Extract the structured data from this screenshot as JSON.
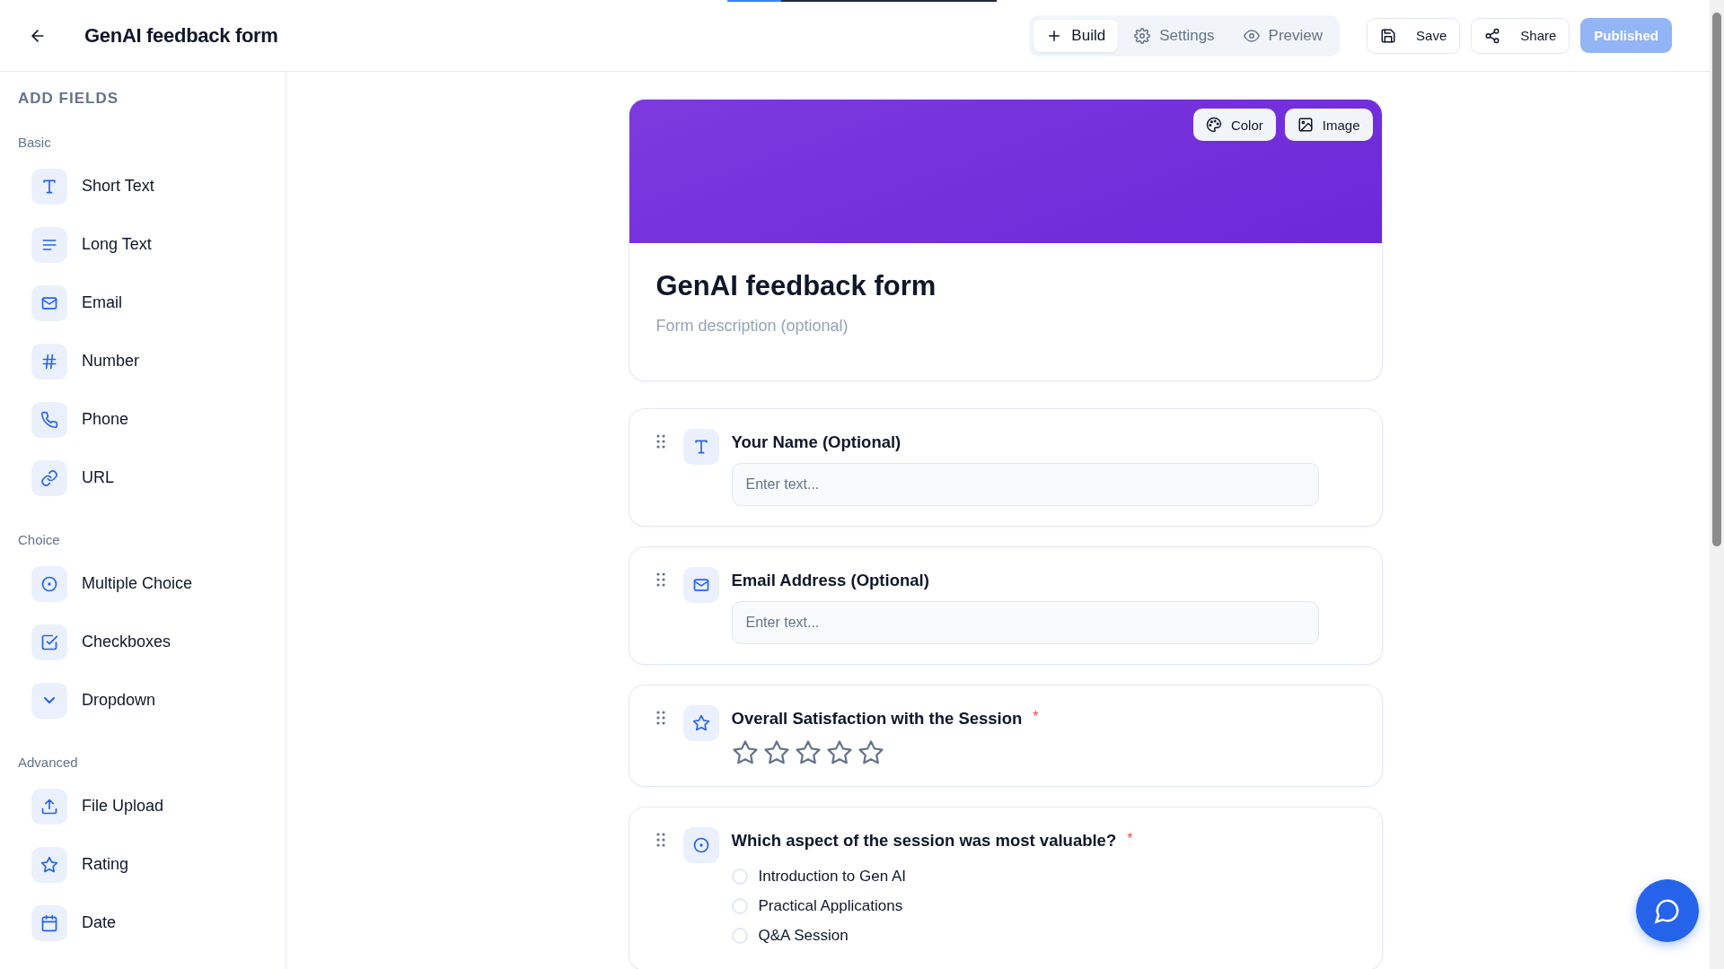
{
  "topbar": {
    "title": "GenAI feedback form",
    "progress": {
      "level": 0.2
    },
    "tabs": [
      {
        "label": "Build",
        "selected": true
      },
      {
        "label": "Settings",
        "selected": false
      },
      {
        "label": "Preview",
        "selected": false
      }
    ],
    "actions": [
      {
        "label": "Save",
        "kind": "outline"
      },
      {
        "label": "Share",
        "kind": "outline"
      },
      {
        "label": "Published",
        "kind": "primary",
        "disabled": true
      }
    ]
  },
  "sidebar": {
    "heading": "ADD FIELDS",
    "sections": [
      {
        "title": "Basic",
        "items": [
          {
            "label": "Short Text"
          },
          {
            "label": "Long Text"
          },
          {
            "label": "Email"
          },
          {
            "label": "Number"
          },
          {
            "label": "Phone"
          },
          {
            "label": "URL"
          }
        ]
      },
      {
        "title": "Choice",
        "items": [
          {
            "label": "Multiple Choice"
          },
          {
            "label": "Checkboxes"
          },
          {
            "label": "Dropdown"
          }
        ]
      },
      {
        "title": "Advanced",
        "items": [
          {
            "label": "File Upload"
          },
          {
            "label": "Rating"
          },
          {
            "label": "Date"
          }
        ]
      }
    ]
  },
  "form": {
    "banner_buttons": [
      {
        "label": "Color"
      },
      {
        "label": "Image"
      }
    ],
    "title": "GenAI feedback form",
    "description": {
      "placeholder": "Form description (optional)"
    },
    "questions": [
      {
        "kind": "text",
        "label": "Your Name (Optional)",
        "placeholder": "Enter text..."
      },
      {
        "kind": "email",
        "label": "Email Address (Optional)",
        "placeholder": "Enter text..."
      },
      {
        "kind": "rating",
        "label": "Overall Satisfaction with the Session",
        "required_mark": "*",
        "stars": 0
      },
      {
        "kind": "choice",
        "label": "Which aspect of the session was most valuable?",
        "required_mark": "*",
        "options": [
          {
            "label": "Introduction to Gen AI",
            "selected": false
          },
          {
            "label": "Practical Applications",
            "selected": false
          },
          {
            "label": "Q&A Session",
            "selected": false
          }
        ]
      }
    ]
  }
}
